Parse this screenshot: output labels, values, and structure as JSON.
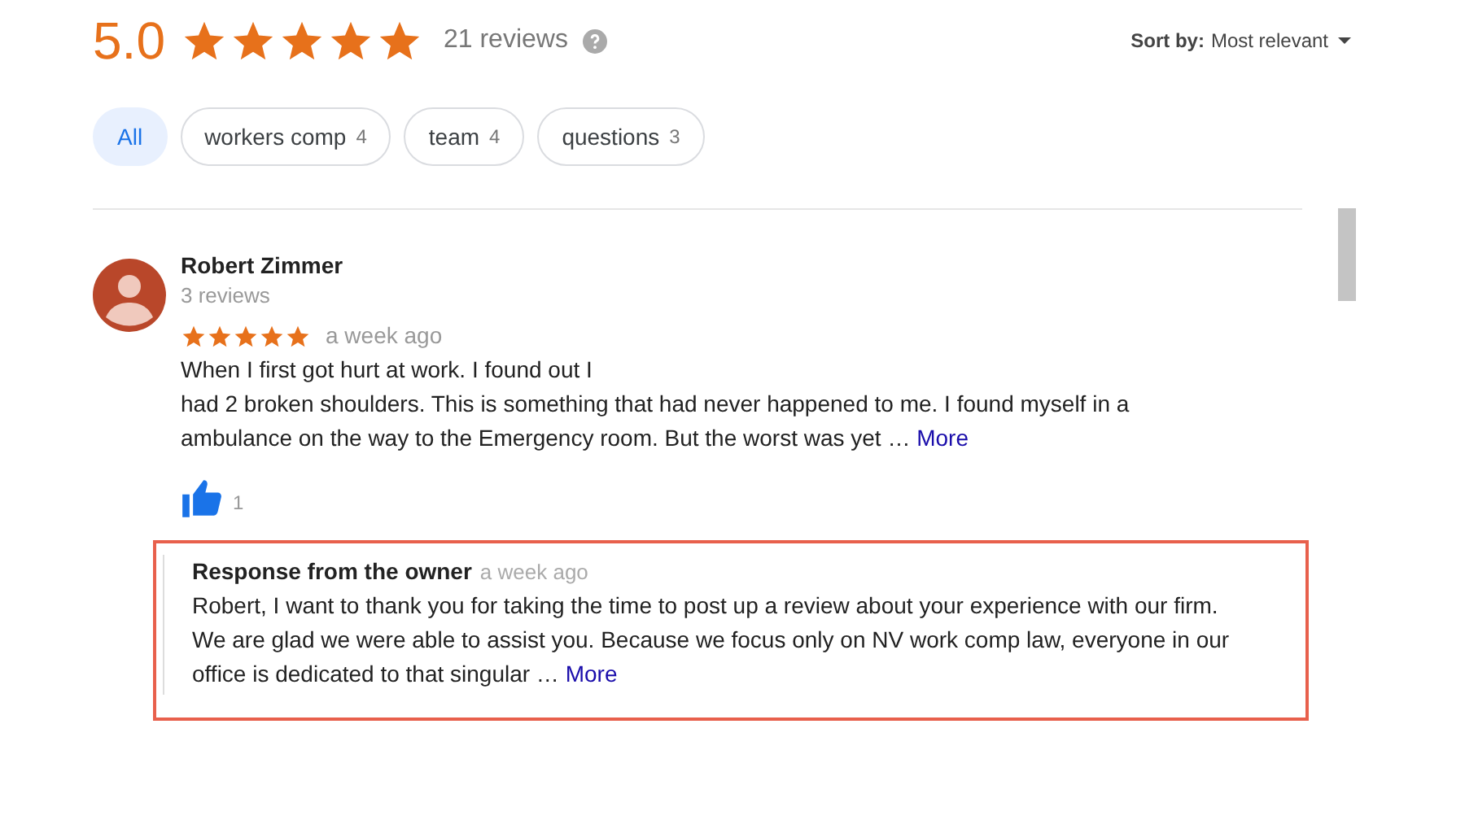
{
  "summary": {
    "rating": "5.0",
    "stars": 5,
    "count": "21 reviews"
  },
  "sort": {
    "label": "Sort by:",
    "value": "Most relevant"
  },
  "filters": [
    {
      "label": "All",
      "selected": true
    },
    {
      "label": "workers comp",
      "count": "4",
      "selected": false
    },
    {
      "label": "team",
      "count": "4",
      "selected": false
    },
    {
      "label": "questions",
      "count": "3",
      "selected": false
    }
  ],
  "review": {
    "author": "Robert Zimmer",
    "author_reviews": "3 reviews",
    "stars": 5,
    "time": "a week ago",
    "text_lines": [
      "When I first got hurt at work. I found out I",
      "had 2 broken shoulders. This is something that had never happened to me. I found myself in a",
      "ambulance on the way to the Emergency room. But the worst was yet …"
    ],
    "more": "More",
    "likes": "1"
  },
  "response": {
    "title": "Response from the owner",
    "time": "a week ago",
    "text_lines": [
      "Robert, I want to thank you for taking the time to post up a review about your experience with our firm.",
      "We are glad we were able to assist you. Because we focus only on NV work comp law, everyone in our",
      "office is dedicated to that singular …"
    ],
    "more": "More"
  }
}
